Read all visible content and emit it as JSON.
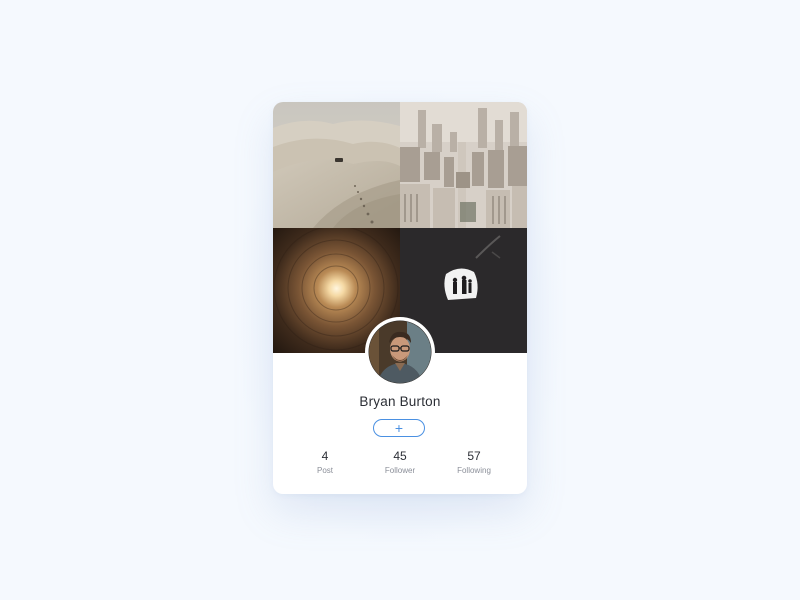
{
  "profile": {
    "name": "Bryan Burton",
    "add_button_label": "+"
  },
  "photos": [
    {
      "name": "desert-dunes-photo"
    },
    {
      "name": "city-aerial-photo"
    },
    {
      "name": "glowing-tunnel-photo"
    },
    {
      "name": "cave-silhouettes-photo"
    }
  ],
  "stats": [
    {
      "value": "4",
      "label": "Post"
    },
    {
      "value": "45",
      "label": "Follower"
    },
    {
      "value": "57",
      "label": "Following"
    }
  ],
  "colors": {
    "accent": "#4a90e2",
    "background": "#f5f9fe",
    "card": "#ffffff",
    "text": "#2c2f36",
    "muted": "#8b8f99"
  }
}
